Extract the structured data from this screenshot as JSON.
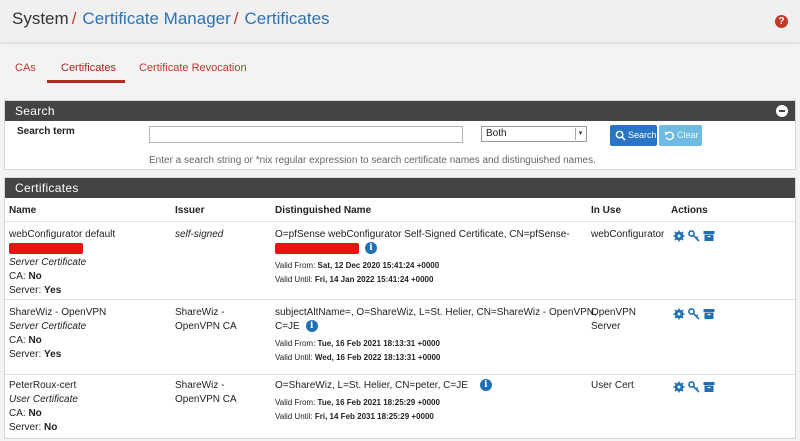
{
  "breadcrumb": [
    "System",
    "Certificate Manager",
    "Certificates"
  ],
  "tabs": [
    {
      "label": "CAs"
    },
    {
      "label": "Certificates"
    },
    {
      "label": "Certificate Revocation"
    }
  ],
  "search": {
    "title": "Search",
    "term_label": "Search term",
    "term_value": "",
    "select_value": "Both",
    "search_button": "Search",
    "clear_button": "Clear",
    "help": "Enter a search string or *nix regular expression to search certificate names and distinguished names."
  },
  "certificates": {
    "title": "Certificates",
    "columns": [
      "Name",
      "Issuer",
      "Distinguished Name",
      "In Use",
      "Actions"
    ],
    "rows": [
      {
        "name": "webConfigurator default",
        "type": "Server Certificate",
        "ca_label": "CA:",
        "ca": "No",
        "server_label": "Server:",
        "server": "Yes",
        "issuer": "self-signed",
        "dn_1": "O=pfSense webConfigurator Self-Signed Certificate, CN=pfSense-",
        "dn_2": "",
        "valid_from_label": "Valid From:",
        "valid_from": "Sat, 12 Dec 2020 15:41:24 +0000",
        "valid_until_label": "Valid Until:",
        "valid_until": "Fri, 14 Jan 2022 15:41:24 +0000",
        "in_use_1": "webConfigurator",
        "in_use_2": ""
      },
      {
        "name": "ShareWiz - OpenVPN",
        "type": "Server Certificate",
        "ca_label": "CA:",
        "ca": "No",
        "server_label": "Server:",
        "server": "Yes",
        "issuer": "ShareWiz -",
        "issuer_2": "OpenVPN CA",
        "dn_1": "subjectAltName=, O=ShareWiz, L=St. Helier, CN=ShareWiz - OpenVPN,",
        "dn_2": "C=JE",
        "valid_from_label": "Valid From:",
        "valid_from": "Tue, 16 Feb 2021 18:13:31 +0000",
        "valid_until_label": "Valid Until:",
        "valid_until": "Wed, 16 Feb 2022 18:13:31 +0000",
        "in_use_1": "OpenVPN",
        "in_use_2": "Server"
      },
      {
        "name": "PeterRoux-cert",
        "type": "User Certificate",
        "ca_label": "CA:",
        "ca": "No",
        "server_label": "Server:",
        "server": "No",
        "issuer": "ShareWiz -",
        "issuer_2": "OpenVPN CA",
        "dn_1": "O=ShareWiz, L=St. Helier, CN=peter, C=JE",
        "dn_2": "",
        "valid_from_label": "Valid From:",
        "valid_from": "Tue, 16 Feb 2021 18:25:29 +0000",
        "valid_until_label": "Valid Until:",
        "valid_until": "Fri, 14 Feb 2031 18:25:29 +0000",
        "in_use_1": "User Cert",
        "in_use_2": ""
      }
    ]
  },
  "icons": {
    "help": "help-icon",
    "collapse": "collapse-icon",
    "search": "search-icon",
    "clear": "undo-icon",
    "info": "info-icon",
    "export": "gear-icon",
    "key": "key-icon",
    "p12": "archive-icon"
  },
  "colors": {
    "accent": "#c0392b",
    "link": "#2a73b8",
    "panel_head": "#444444",
    "action": "#1f6fb5"
  }
}
